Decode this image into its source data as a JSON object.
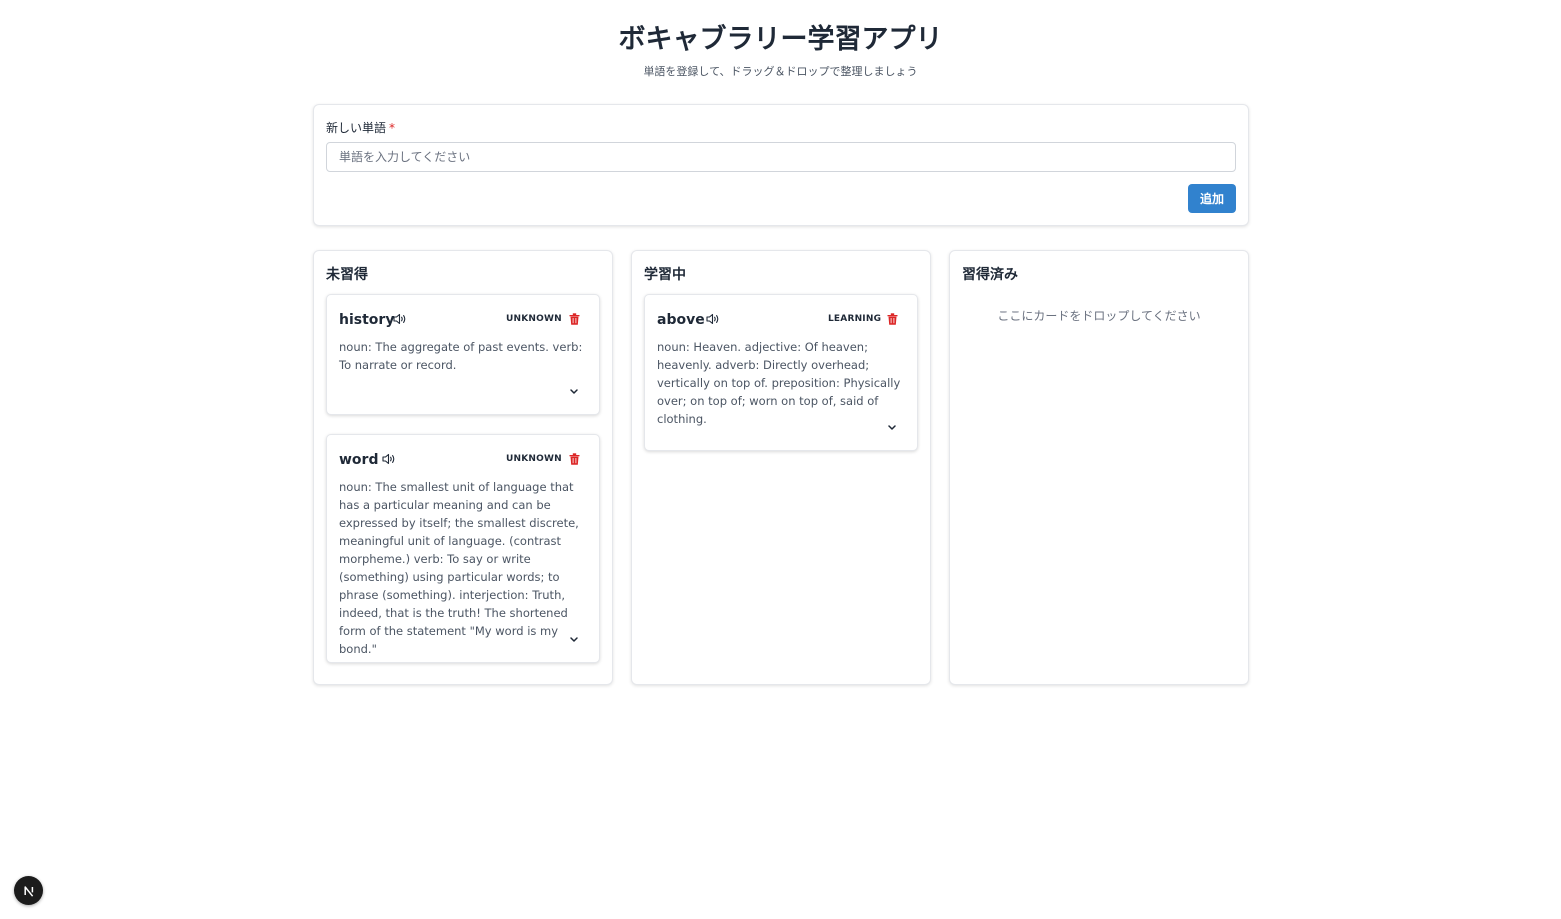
{
  "header": {
    "title": "ボキャブラリー学習アプリ",
    "subtitle": "単語を登録して、ドラッグ＆ドロップで整理しましょう"
  },
  "form": {
    "label": "新しい単語",
    "required_mark": "*",
    "input_value": "",
    "input_placeholder": "単語を入力してください",
    "add_button_label": "追加"
  },
  "columns": [
    {
      "title": "未習得",
      "cards": [
        {
          "word": "history",
          "status": "UNKNOWN",
          "definition": "noun: The aggregate of past events. verb: To narrate or record."
        },
        {
          "word": "word",
          "status": "UNKNOWN",
          "definition": "noun: The smallest unit of language that has a particular meaning and can be expressed by itself; the smallest discrete, meaningful unit of language. (contrast morpheme.) verb: To say or write (something) using particular words; to phrase (something). interjection: Truth, indeed, that is the truth! The shortened form of the statement \"My word is my bond.\""
        }
      ]
    },
    {
      "title": "学習中",
      "cards": [
        {
          "word": "above",
          "status": "LEARNING",
          "definition": "noun: Heaven. adjective: Of heaven; heavenly. adverb: Directly overhead; vertically on top of. preposition: Physically over; on top of; worn on top of, said of clothing."
        }
      ]
    },
    {
      "title": "習得済み",
      "empty_hint": "ここにカードをドロップしてください",
      "cards": []
    }
  ],
  "icons": {
    "speaker": "speaker-icon",
    "delete": "trash-icon",
    "expand": "chevron-down-icon",
    "devtools": "nextjs-logo-icon"
  },
  "colors": {
    "primary": "#3182ce",
    "danger": "#dc2626",
    "text": "#1f2937",
    "muted": "#4b5563",
    "border": "#e5e7eb"
  },
  "devtools": {
    "letter": "N"
  }
}
